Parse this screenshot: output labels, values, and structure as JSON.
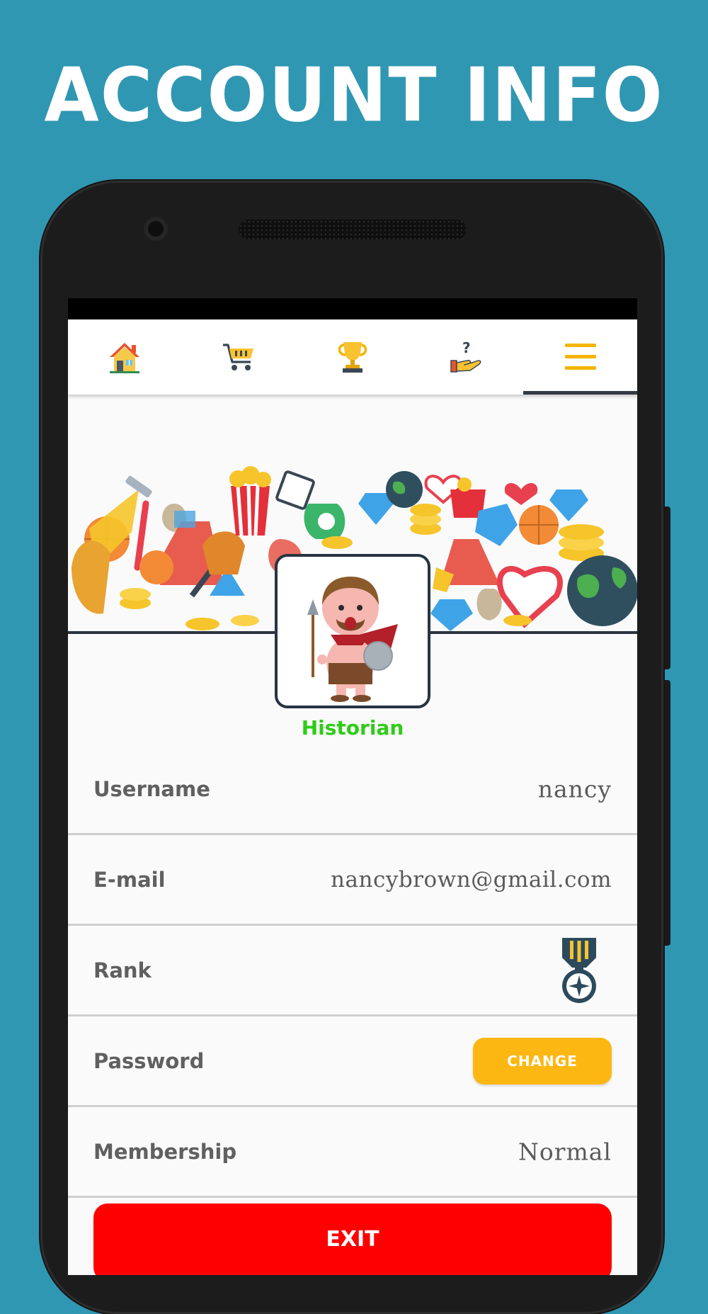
{
  "promo": {
    "title": "ACCOUNT INFO"
  },
  "nav": {
    "items": [
      {
        "icon": "home-icon",
        "active": false
      },
      {
        "icon": "cart-icon",
        "active": false
      },
      {
        "icon": "trophy-icon",
        "active": false
      },
      {
        "icon": "help-hand-icon",
        "active": false
      },
      {
        "icon": "menu-icon",
        "active": true
      }
    ]
  },
  "profile": {
    "avatar_icon": "gladiator-avatar-icon",
    "title": "Historian"
  },
  "account": {
    "username_label": "Username",
    "username_value": "nancy",
    "email_label": "E-mail",
    "email_value": "nancybrown@gmail.com",
    "rank_label": "Rank",
    "rank_icon": "medal-icon",
    "password_label": "Password",
    "change_label": "CHANGE",
    "membership_label": "Membership",
    "membership_value": "Normal"
  },
  "exit_label": "EXIT",
  "colors": {
    "background": "#3097b2",
    "accent_yellow": "#fdb712",
    "title_green": "#2ecc16",
    "exit_red": "#ff0000",
    "navy": "#283442"
  }
}
